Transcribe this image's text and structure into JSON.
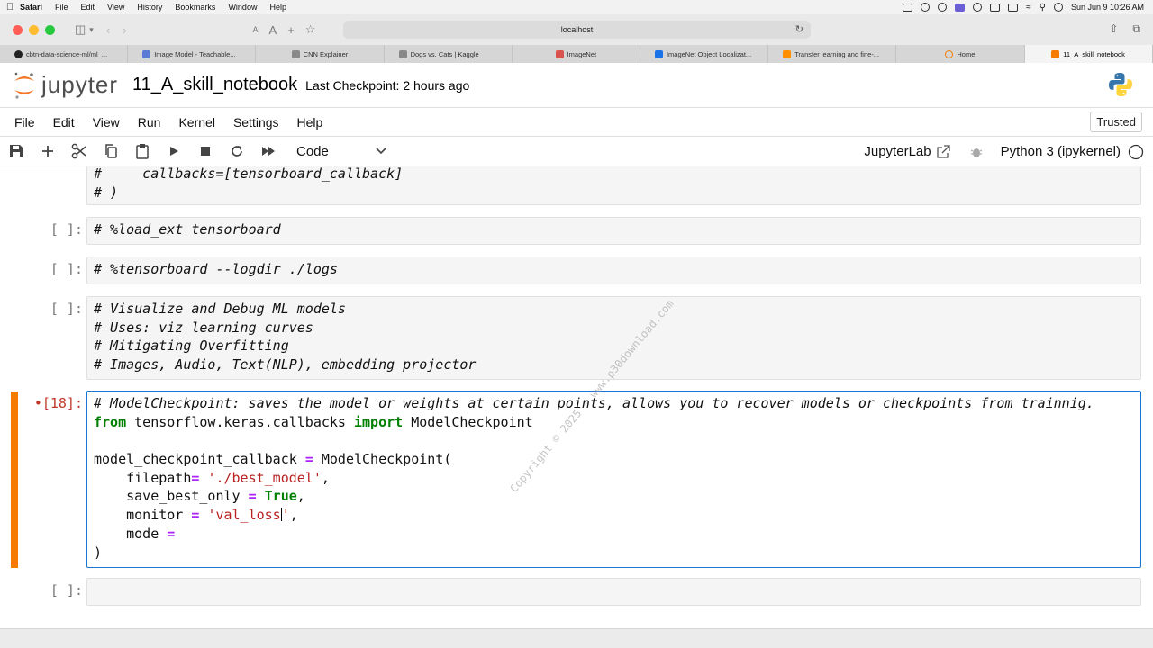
{
  "macos": {
    "app": "Safari",
    "menus": [
      "File",
      "Edit",
      "View",
      "History",
      "Bookmarks",
      "Window",
      "Help"
    ],
    "clock": "Sun Jun 9  10:26 AM"
  },
  "safari": {
    "address": "localhost",
    "tabs": [
      {
        "label": "cbtn-data-science-ml/ml_..."
      },
      {
        "label": "Image Model - Teachable..."
      },
      {
        "label": "CNN Explainer"
      },
      {
        "label": "Dogs vs. Cats | Kaggle"
      },
      {
        "label": "ImageNet"
      },
      {
        "label": "ImageNet Object Localizat..."
      },
      {
        "label": "Transfer learning and fine-..."
      },
      {
        "label": "Home"
      },
      {
        "label": "11_A_skill_notebook"
      }
    ]
  },
  "jupyter": {
    "logo_text": "jupyter",
    "notebook_name": "11_A_skill_notebook",
    "checkpoint": "Last Checkpoint: 2 hours ago",
    "menu": [
      "File",
      "Edit",
      "View",
      "Run",
      "Kernel",
      "Settings",
      "Help"
    ],
    "trusted": "Trusted",
    "cell_type": "Code",
    "jupyterlab_label": "JupyterLab",
    "kernel": "Python 3 (ipykernel)"
  },
  "cells": {
    "c0": {
      "lines": [
        "#     callbacks=[tensorboard_callback]",
        "# )"
      ]
    },
    "c1": {
      "prompt": "[ ]:",
      "line": "# %load_ext tensorboard"
    },
    "c2": {
      "prompt": "[ ]:",
      "line": "# %tensorboard --logdir ./logs"
    },
    "c3": {
      "prompt": "[ ]:",
      "lines": [
        "# Visualize and Debug ML models",
        "# Uses: viz learning curves",
        "# Mitigating Overfitting",
        "# Images, Audio, Text(NLP), embedding projector"
      ]
    },
    "c4": {
      "prompt": "•[18]:",
      "comment": "# ModelCheckpoint: saves the model or weights at certain points, allows you to recover models or checkpoints from trainnig.",
      "kw_from": "from",
      "module": " tensorflow.keras.callbacks ",
      "kw_import": "import",
      "imported": " ModelCheckpoint",
      "assign_lhs": "model_checkpoint_callback ",
      "assign_eq": "=",
      "assign_rhs": " ModelCheckpoint(",
      "arg1_name": "    filepath",
      "arg1_eq": "=",
      "arg1_val": "'./best_model'",
      "arg2_name": "    save_best_only ",
      "arg2_eq": "=",
      "arg2_val": "True",
      "arg3_name": "    monitor ",
      "arg3_eq": "=",
      "arg3_val_a": "'val_loss",
      "arg3_val_b": "'",
      "arg4_name": "    mode ",
      "arg4_eq": "=",
      "close": ")"
    },
    "c5": {
      "prompt": "[ ]:"
    }
  },
  "watermark": "Copyright © 2025 - www.p30download.com",
  "colors": {
    "accent": "#f57c00",
    "selection_border": "#1976d2",
    "prompt_active": "#c0392b"
  }
}
